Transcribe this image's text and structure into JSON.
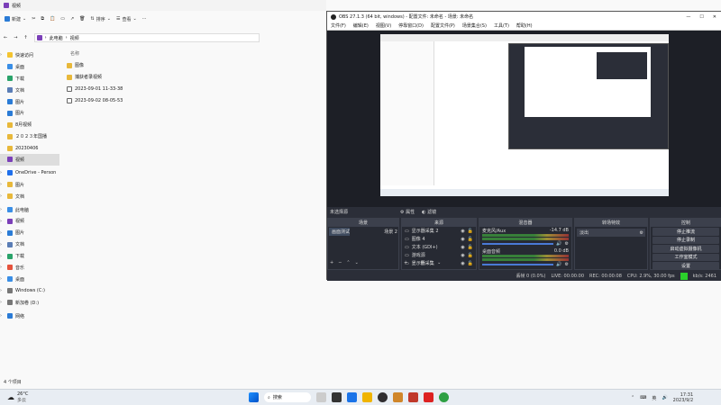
{
  "explorer": {
    "title": "视频",
    "cmd": {
      "new": "新建",
      "sort": "排序",
      "view": "查看"
    },
    "path": [
      "此电脑",
      "视频"
    ],
    "nav": [
      {
        "label": "快速访问",
        "icon": "star-icon",
        "exp": true
      },
      {
        "label": "桌面",
        "icon": "desktop-icon"
      },
      {
        "label": "下载",
        "icon": "download-icon"
      },
      {
        "label": "文档",
        "icon": "document-icon"
      },
      {
        "label": "图片",
        "icon": "picture-icon"
      },
      {
        "label": "图片",
        "icon": "picture-icon"
      },
      {
        "label": "8月视频",
        "icon": "folder-icon"
      },
      {
        "label": "２０２３年国播",
        "icon": "folder-icon"
      },
      {
        "label": "20230406",
        "icon": "folder-icon"
      },
      {
        "label": "视频",
        "icon": "video-icon",
        "sel": true
      },
      {
        "label": "OneDrive - Person",
        "icon": "cloud-icon",
        "exp": true,
        "gap": true
      },
      {
        "label": "图片",
        "icon": "folder-icon",
        "exp": true
      },
      {
        "label": "文档",
        "icon": "folder-icon",
        "exp": true
      },
      {
        "label": "此电脑",
        "icon": "pc-icon",
        "exp": true,
        "gap": true
      },
      {
        "label": "视频",
        "icon": "video-icon",
        "exp": true
      },
      {
        "label": "图片",
        "icon": "picture-icon",
        "exp": true
      },
      {
        "label": "文档",
        "icon": "document-icon",
        "exp": true
      },
      {
        "label": "下载",
        "icon": "download-icon",
        "exp": true
      },
      {
        "label": "音乐",
        "icon": "music-icon",
        "exp": true
      },
      {
        "label": "桌面",
        "icon": "desktop-icon",
        "exp": true
      },
      {
        "label": "Windows (C:)",
        "icon": "drive-icon",
        "exp": true
      },
      {
        "label": "新加卷 (D:)",
        "icon": "drive-icon",
        "exp": true
      },
      {
        "label": "网络",
        "icon": "network-icon",
        "exp": true,
        "gap": true
      }
    ],
    "col": "名称",
    "files": [
      "图像",
      "捕获者录视频",
      "2023-09-01 11-33-38",
      "2023-09-02 08-05-53"
    ],
    "status": "4 个项目"
  },
  "obs": {
    "title": "OBS 27.1.3 (64 bit, windows) - 配置文件: 未命名 - 场景: 未命名",
    "menu": [
      "文件(F)",
      "编辑(E)",
      "视图(V)",
      "停靠窗口(D)",
      "配置文件(P)",
      "场景集合(S)",
      "工具(T)",
      "帮助(H)"
    ],
    "nosrc": "未选择源",
    "props": "属性",
    "filters": "滤镜",
    "scenes": {
      "h": "场景",
      "items": [
        "画面测试",
        "场景 2"
      ]
    },
    "sources": {
      "h": "来源",
      "items": [
        "显示器采集 2",
        "图像 4",
        "文本 (GDI+)",
        "游戏源",
        "显示器采集"
      ]
    },
    "mixer": {
      "h": "混音器",
      "tracks": [
        {
          "name": "麦克风/Aux",
          "db": "-14.7 dB"
        },
        {
          "name": "桌面音频",
          "db": "0.0 dB"
        }
      ]
    },
    "trans": {
      "h": "转场特效",
      "fade": "淡出"
    },
    "controls": {
      "h": "控制",
      "btns": [
        "停止推流",
        "停止录制",
        "启动虚拟摄像机",
        "工作室模式",
        "设置",
        "退出"
      ]
    },
    "statusbar": [
      "丢帧 0 (0.0%)",
      "LIVE: 00:00:00",
      "REC: 00:00:08",
      "CPU: 2.9%, 30.00 fps",
      "kb/s: 2461"
    ]
  },
  "taskbar": {
    "weather": "26°C",
    "wsub": "多云",
    "search": "搜索",
    "ime": "英",
    "time": "17:31",
    "date": "2023/9/2"
  }
}
